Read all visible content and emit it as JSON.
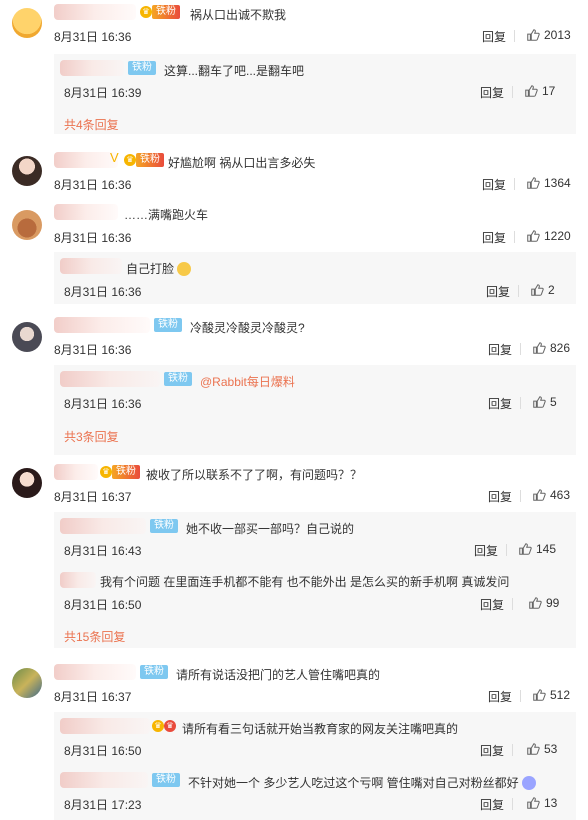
{
  "ui": {
    "reply_label": "回复"
  },
  "comments": [
    {
      "text": "祸从口出诚不欺我",
      "time": "8月31日 16:36",
      "likes": "2013",
      "badge": "铁粉"
    },
    {
      "text": "这算...翻车了吧...是翻车吧",
      "time": "8月31日 16:39",
      "likes": "17",
      "badge": "铁粉"
    },
    {
      "more": "共4条回复"
    },
    {
      "text": "好尴尬啊 祸从口出言多必失",
      "time": "8月31日 16:36",
      "likes": "1364",
      "badge": "铁粉"
    },
    {
      "text": "……满嘴跑火车",
      "time": "8月31日 16:36",
      "likes": "1220"
    },
    {
      "text": "自己打脸",
      "time": "8月31日 16:36",
      "likes": "2"
    },
    {
      "text": "冷酸灵冷酸灵冷酸灵?",
      "time": "8月31日 16:36",
      "likes": "826",
      "badge": "铁粉"
    },
    {
      "mention": "@Rabbit每日爆料",
      "time": "8月31日 16:36",
      "likes": "5",
      "badge": "铁粉"
    },
    {
      "more": "共3条回复"
    },
    {
      "text": "被收了所以联系不了了啊，有问题吗？？",
      "time": "8月31日 16:37",
      "likes": "463",
      "badge": "铁粉"
    },
    {
      "text": "她不收一部买一部吗？自己说的",
      "time": "8月31日 16:43",
      "likes": "145",
      "badge": "铁粉"
    },
    {
      "text": "我有个问题  在里面连手机都不能有  也不能外出  是怎么买的新手机啊  真诚发问",
      "time": "8月31日 16:50",
      "likes": "99"
    },
    {
      "more": "共15条回复"
    },
    {
      "text": "请所有说话没把门的艺人管住嘴吧真的",
      "time": "8月31日 16:37",
      "likes": "512",
      "badge": "铁粉"
    },
    {
      "text": "请所有看三句话就开始当教育家的网友关注嘴吧真的",
      "time": "8月31日 16:50",
      "likes": "53"
    },
    {
      "text": "不针对她一个 多少艺人吃过这个亏啊 管住嘴对自己对粉丝都好",
      "time": "8月31日 17:23",
      "likes": "13",
      "badge": "铁粉"
    }
  ],
  "icons": {
    "thumb": "thumbs-up-icon",
    "crown": "vip-crown-icon"
  },
  "colors": {
    "link": "#eb7350",
    "badge": "#7ec8f0",
    "subbox": "#f7f7f7"
  }
}
